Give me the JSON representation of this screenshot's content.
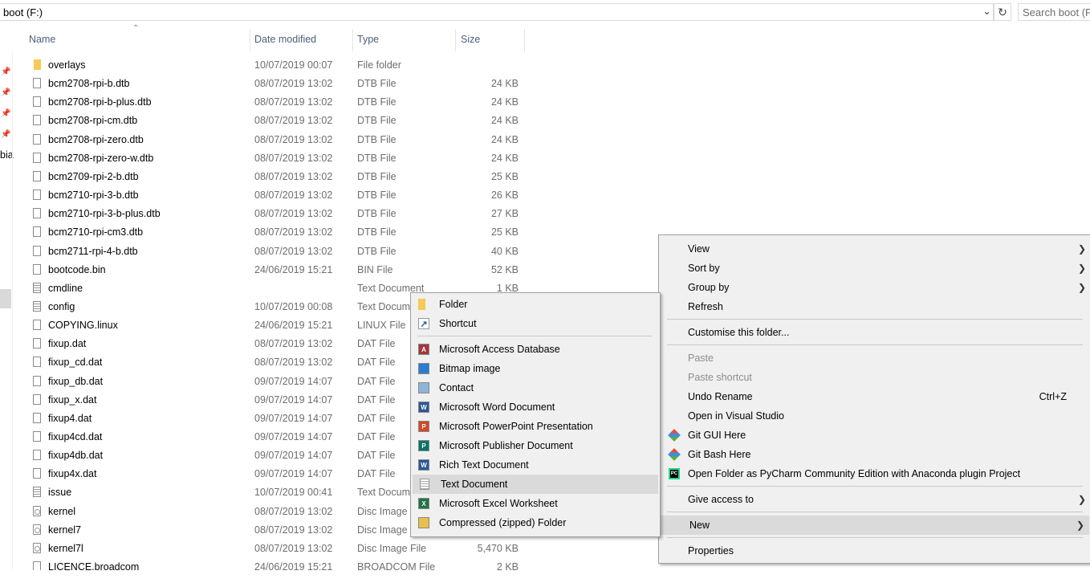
{
  "address_bar": {
    "path": "boot (F:)",
    "search_placeholder": "Search boot (F:)"
  },
  "columns": [
    "Name",
    "Date modified",
    "Type",
    "Size"
  ],
  "sidebar": {
    "partial_label": "bia"
  },
  "files": [
    {
      "name": "overlays",
      "date": "10/07/2019 00:07",
      "type": "File folder",
      "size": "",
      "icon": "folder"
    },
    {
      "name": "bcm2708-rpi-b.dtb",
      "date": "08/07/2019 13:02",
      "type": "DTB File",
      "size": "24 KB",
      "icon": "file"
    },
    {
      "name": "bcm2708-rpi-b-plus.dtb",
      "date": "08/07/2019 13:02",
      "type": "DTB File",
      "size": "24 KB",
      "icon": "file"
    },
    {
      "name": "bcm2708-rpi-cm.dtb",
      "date": "08/07/2019 13:02",
      "type": "DTB File",
      "size": "24 KB",
      "icon": "file"
    },
    {
      "name": "bcm2708-rpi-zero.dtb",
      "date": "08/07/2019 13:02",
      "type": "DTB File",
      "size": "24 KB",
      "icon": "file"
    },
    {
      "name": "bcm2708-rpi-zero-w.dtb",
      "date": "08/07/2019 13:02",
      "type": "DTB File",
      "size": "24 KB",
      "icon": "file"
    },
    {
      "name": "bcm2709-rpi-2-b.dtb",
      "date": "08/07/2019 13:02",
      "type": "DTB File",
      "size": "25 KB",
      "icon": "file"
    },
    {
      "name": "bcm2710-rpi-3-b.dtb",
      "date": "08/07/2019 13:02",
      "type": "DTB File",
      "size": "26 KB",
      "icon": "file"
    },
    {
      "name": "bcm2710-rpi-3-b-plus.dtb",
      "date": "08/07/2019 13:02",
      "type": "DTB File",
      "size": "27 KB",
      "icon": "file"
    },
    {
      "name": "bcm2710-rpi-cm3.dtb",
      "date": "08/07/2019 13:02",
      "type": "DTB File",
      "size": "25 KB",
      "icon": "file"
    },
    {
      "name": "bcm2711-rpi-4-b.dtb",
      "date": "08/07/2019 13:02",
      "type": "DTB File",
      "size": "40 KB",
      "icon": "file"
    },
    {
      "name": "bootcode.bin",
      "date": "24/06/2019 15:21",
      "type": "BIN File",
      "size": "52 KB",
      "icon": "file"
    },
    {
      "name": "cmdline",
      "date": "",
      "type": "Text Document",
      "size": "1 KB",
      "icon": "text"
    },
    {
      "name": "config",
      "date": "10/07/2019 00:08",
      "type": "Text Document",
      "size": "",
      "icon": "text"
    },
    {
      "name": "COPYING.linux",
      "date": "24/06/2019 15:21",
      "type": "LINUX File",
      "size": "",
      "icon": "file"
    },
    {
      "name": "fixup.dat",
      "date": "08/07/2019 13:02",
      "type": "DAT File",
      "size": "",
      "icon": "file"
    },
    {
      "name": "fixup_cd.dat",
      "date": "08/07/2019 13:02",
      "type": "DAT File",
      "size": "",
      "icon": "file"
    },
    {
      "name": "fixup_db.dat",
      "date": "09/07/2019 14:07",
      "type": "DAT File",
      "size": "",
      "icon": "file"
    },
    {
      "name": "fixup_x.dat",
      "date": "09/07/2019 14:07",
      "type": "DAT File",
      "size": "",
      "icon": "file"
    },
    {
      "name": "fixup4.dat",
      "date": "09/07/2019 14:07",
      "type": "DAT File",
      "size": "",
      "icon": "file"
    },
    {
      "name": "fixup4cd.dat",
      "date": "09/07/2019 14:07",
      "type": "DAT File",
      "size": "",
      "icon": "file"
    },
    {
      "name": "fixup4db.dat",
      "date": "09/07/2019 14:07",
      "type": "DAT File",
      "size": "",
      "icon": "file"
    },
    {
      "name": "fixup4x.dat",
      "date": "09/07/2019 14:07",
      "type": "DAT File",
      "size": "",
      "icon": "file"
    },
    {
      "name": "issue",
      "date": "10/07/2019 00:41",
      "type": "Text Document",
      "size": "",
      "icon": "text"
    },
    {
      "name": "kernel",
      "date": "08/07/2019 13:02",
      "type": "Disc Image File",
      "size": "",
      "icon": "disc"
    },
    {
      "name": "kernel7",
      "date": "08/07/2019 13:02",
      "type": "Disc Image File",
      "size": "",
      "icon": "disc"
    },
    {
      "name": "kernel7l",
      "date": "08/07/2019 13:02",
      "type": "Disc Image File",
      "size": "5,470 KB",
      "icon": "disc"
    },
    {
      "name": "LICENCE.broadcom",
      "date": "24/06/2019 15:21",
      "type": "BROADCOM File",
      "size": "2 KB",
      "icon": "file"
    }
  ],
  "context_menu": {
    "items": [
      {
        "label": "View",
        "submenu": true
      },
      {
        "label": "Sort by",
        "submenu": true
      },
      {
        "label": "Group by",
        "submenu": true
      },
      {
        "label": "Refresh"
      },
      {
        "separator": true
      },
      {
        "label": "Customise this folder..."
      },
      {
        "separator": true
      },
      {
        "label": "Paste",
        "disabled": true
      },
      {
        "label": "Paste shortcut",
        "disabled": true
      },
      {
        "label": "Undo Rename",
        "shortcut": "Ctrl+Z"
      },
      {
        "label": "Open in Visual Studio"
      },
      {
        "label": "Git GUI Here",
        "icon": "git"
      },
      {
        "label": "Git Bash Here",
        "icon": "git"
      },
      {
        "label": "Open Folder as PyCharm Community Edition with Anaconda plugin Project",
        "icon": "pycharm"
      },
      {
        "separator": true
      },
      {
        "label": "Give access to",
        "submenu": true
      },
      {
        "separator": true
      },
      {
        "label": "New",
        "submenu": true,
        "highlighted": true
      },
      {
        "separator": true
      },
      {
        "label": "Properties"
      }
    ]
  },
  "new_submenu": {
    "items": [
      {
        "label": "Folder",
        "icon": "folder"
      },
      {
        "label": "Shortcut",
        "icon": "shortcut"
      },
      {
        "separator": true
      },
      {
        "label": "Microsoft Access Database",
        "icon": "access",
        "color": "#a4373a",
        "letter": "A"
      },
      {
        "label": "Bitmap image",
        "icon": "bitmap",
        "color": "#2b7cd3",
        "letter": ""
      },
      {
        "label": "Contact",
        "icon": "contact",
        "color": "#8fb4d9",
        "letter": ""
      },
      {
        "label": "Microsoft Word Document",
        "icon": "word",
        "color": "#2b579a",
        "letter": "W"
      },
      {
        "label": "Microsoft PowerPoint Presentation",
        "icon": "powerpoint",
        "color": "#d24726",
        "letter": "P"
      },
      {
        "label": "Microsoft Publisher Document",
        "icon": "publisher",
        "color": "#077568",
        "letter": "P"
      },
      {
        "label": "Rich Text Document",
        "icon": "rtf",
        "color": "#2b579a",
        "letter": "W"
      },
      {
        "label": "Text Document",
        "icon": "text",
        "highlighted": true
      },
      {
        "label": "Microsoft Excel Worksheet",
        "icon": "excel",
        "color": "#217346",
        "letter": "X"
      },
      {
        "label": "Compressed (zipped) Folder",
        "icon": "zip",
        "color": "#e8c04a",
        "letter": ""
      }
    ]
  }
}
